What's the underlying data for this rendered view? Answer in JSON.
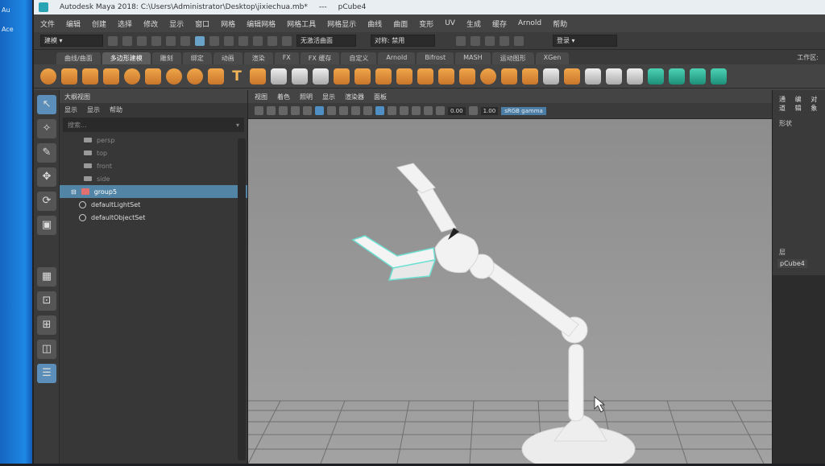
{
  "desktop": {
    "side_text_1": "Au",
    "side_text_2": "Ace"
  },
  "titlebar": {
    "title": "Autodesk Maya 2018: C:\\Users\\Administrator\\Desktop\\jixiechua.mb*",
    "separator": "---",
    "object": "pCube4"
  },
  "menubar": {
    "items": [
      "文件",
      "编辑",
      "创建",
      "选择",
      "修改",
      "显示",
      "窗口",
      "网格",
      "编辑网格",
      "网格工具",
      "网格显示",
      "曲线",
      "曲面",
      "变形",
      "UV",
      "生成",
      "缓存",
      "Arnold",
      "帮助"
    ]
  },
  "statusline": {
    "mode": "建模",
    "live_surface": "无激活曲面",
    "symmetry": "对称: 禁用",
    "login": "登录"
  },
  "shelf": {
    "tabs": [
      "曲线/曲面",
      "多边形建模",
      "雕刻",
      "绑定",
      "动画",
      "渲染",
      "FX",
      "FX 缓存",
      "自定义",
      "Arnold",
      "Bifrost",
      "MASH",
      "运动图形",
      "XGen"
    ],
    "active_tab": 1,
    "workspace_label": "工作区:"
  },
  "outliner": {
    "title": "大纲视图",
    "menu": [
      "显示",
      "显示",
      "帮助"
    ],
    "search_placeholder": "搜索...",
    "cameras": [
      "persp",
      "top",
      "front",
      "side"
    ],
    "group": "group5",
    "sets": [
      "defaultLightSet",
      "defaultObjectSet"
    ]
  },
  "viewport": {
    "menu": [
      "视图",
      "着色",
      "照明",
      "显示",
      "渲染器",
      "面板"
    ],
    "near_value": "0.00",
    "far_value": "1.00",
    "color_space": "sRGB gamma"
  },
  "channel_box": {
    "tabs": [
      "通道",
      "编辑",
      "对象"
    ],
    "sub": "形状",
    "layers_label": "层",
    "layers_value": "pCube4"
  },
  "colors": {
    "accent": "#5285a5",
    "shelf_orange": "#f0a64a",
    "viewport_bg": "#9a9a9a",
    "model": "#f2f2f2"
  }
}
